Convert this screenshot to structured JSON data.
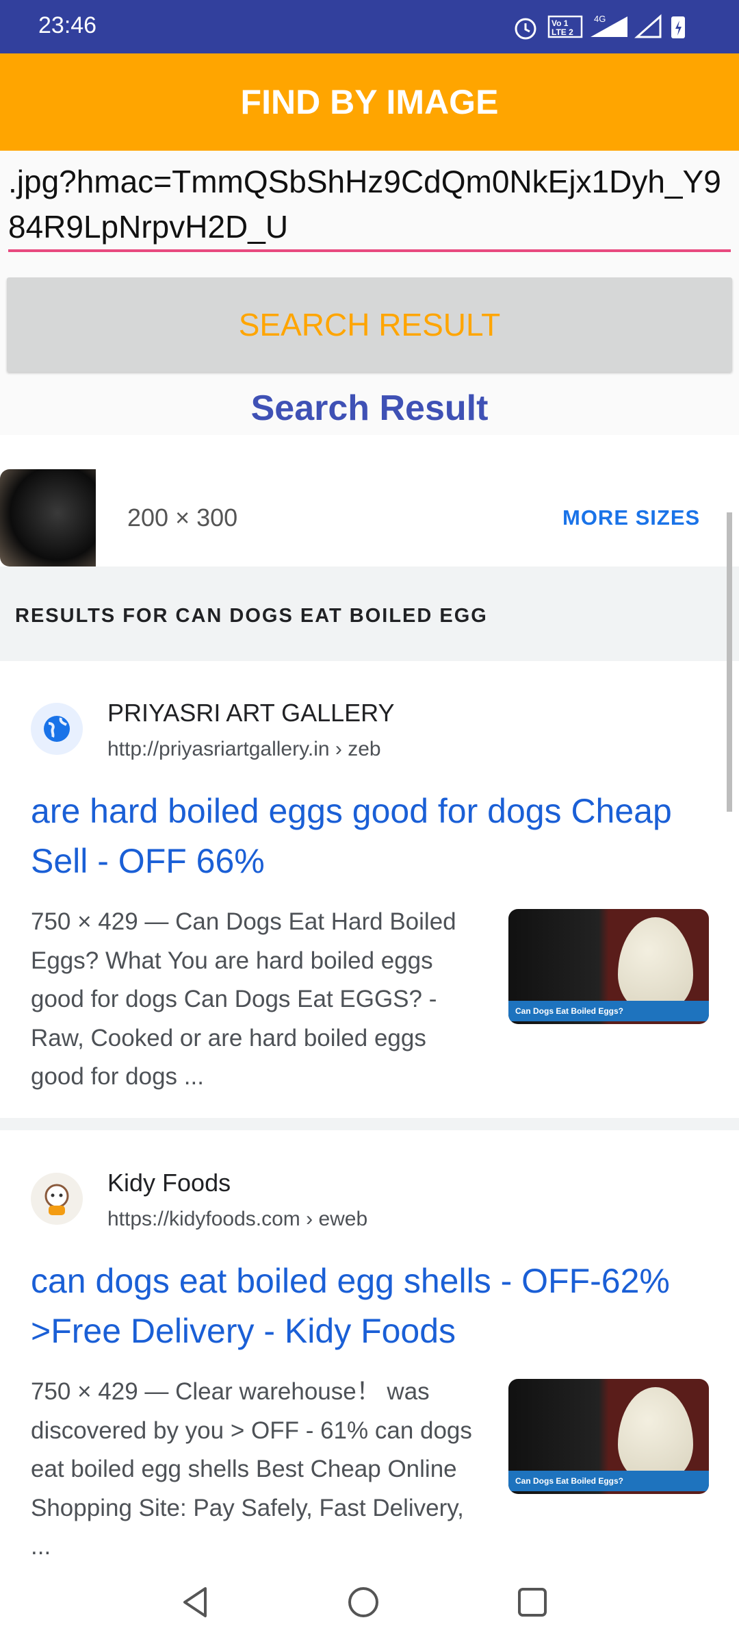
{
  "status_bar": {
    "time": "23:46",
    "icons": [
      "alarm-icon",
      "volte-icon",
      "4g-signal-icon",
      "signal-icon",
      "battery-charging-icon"
    ]
  },
  "app_bar": {
    "title": "FIND BY IMAGE"
  },
  "url_input": {
    "value": ".jpg?hmac=TmmQSbShHz9CdQm0NkEjx1Dyh_Y984R9LpNrpvH2D_U"
  },
  "search_button": {
    "label": "SEARCH RESULT"
  },
  "heading": "Search Result",
  "image_info": {
    "dimensions": "200 × 300",
    "more_sizes": "MORE SIZES"
  },
  "results_header": "RESULTS FOR CAN DOGS EAT BOILED EGG",
  "results": [
    {
      "site": "PRIYASRI ART GALLERY",
      "url": "http://priyasriartgallery.in",
      "url_path": " › zeb",
      "title": "are hard boiled eggs good for dogs Cheap Sell - OFF 66%",
      "snippet": "750 × 429 — Can Dogs Eat Hard Boiled Eggs? What You are hard boiled eggs good for dogs Can Dogs Eat EGGS? - Raw, Cooked or are hard boiled eggs good for dogs ...",
      "thumb_caption": "Can Dogs Eat Boiled Eggs?"
    },
    {
      "site": "Kidy Foods",
      "url": "https://kidyfoods.com",
      "url_path": " › eweb",
      "title": "can dogs eat boiled egg shells - OFF-62% >Free Delivery - Kidy Foods",
      "snippet": "750 × 429 — Clear warehouse！ was discovered by you > OFF - 61% can dogs eat boiled egg shells Best Cheap Online Shopping Site: Pay Safely, Fast Delivery, ...",
      "thumb_caption": "Can Dogs Eat Boiled Eggs?"
    }
  ],
  "colors": {
    "status_bar": "#32409d",
    "app_bar": "#ffa500",
    "accent_underline": "#e84a7f",
    "heading": "#3f51b5",
    "link": "#1a5fd6"
  }
}
